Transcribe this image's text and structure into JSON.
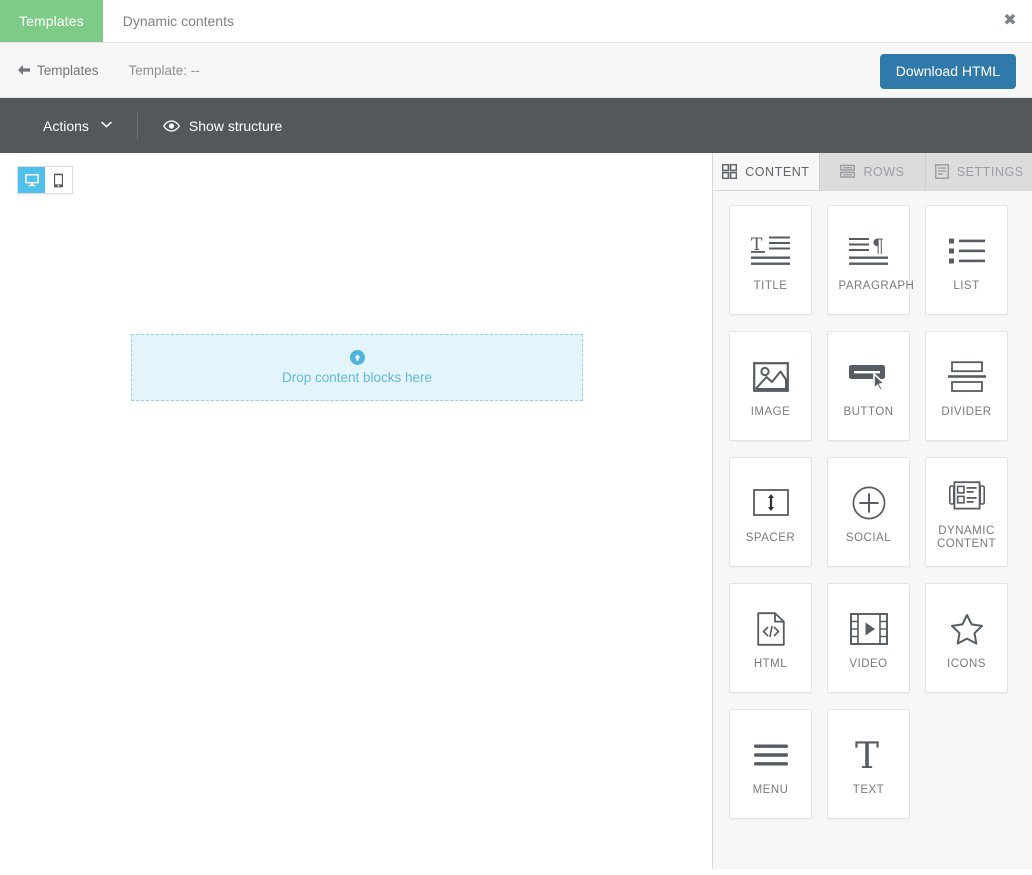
{
  "topbar": {
    "tabs": [
      {
        "label": "Templates",
        "active": true
      },
      {
        "label": "Dynamic contents",
        "active": false
      }
    ],
    "close_icon": "close-icon",
    "active_tab_color": "#7dcb87"
  },
  "subbar": {
    "back_label": "Templates",
    "back_icon": "arrow-left-icon",
    "template_label": "Template: --",
    "download_button": "Download HTML",
    "download_button_color": "#3079ab"
  },
  "toolbar": {
    "actions_label": "Actions",
    "actions_caret_icon": "chevron-down-icon",
    "show_structure_label": "Show structure",
    "show_structure_icon": "eye-icon",
    "background_color": "#52585c"
  },
  "canvas": {
    "device_toggle": [
      {
        "name": "desktop",
        "icon": "desktop-icon",
        "active": true
      },
      {
        "name": "mobile",
        "icon": "mobile-icon",
        "active": false
      }
    ],
    "active_device_color": "#4fc0ea",
    "dropzone": {
      "text": "Drop content blocks here",
      "icon": "arrow-up-circle-icon",
      "background_color": "#e3f4fb",
      "border_color": "#8ed2ec"
    }
  },
  "panel": {
    "tabs": [
      {
        "label": "CONTENT",
        "icon": "grid-icon",
        "active": true
      },
      {
        "label": "ROWS",
        "icon": "rows-icon",
        "active": false
      },
      {
        "label": "SETTINGS",
        "icon": "settings-document-icon",
        "active": false
      }
    ],
    "blocks": [
      {
        "label": "TITLE",
        "icon": "title-icon"
      },
      {
        "label": "PARAGRAPH",
        "icon": "paragraph-icon"
      },
      {
        "label": "LIST",
        "icon": "list-icon"
      },
      {
        "label": "IMAGE",
        "icon": "image-icon"
      },
      {
        "label": "BUTTON",
        "icon": "button-icon"
      },
      {
        "label": "DIVIDER",
        "icon": "divider-icon"
      },
      {
        "label": "SPACER",
        "icon": "spacer-icon"
      },
      {
        "label": "SOCIAL",
        "icon": "social-plus-icon"
      },
      {
        "label": "DYNAMIC CONTENT",
        "icon": "dynamic-content-icon"
      },
      {
        "label": "HTML",
        "icon": "html-code-icon"
      },
      {
        "label": "VIDEO",
        "icon": "video-icon"
      },
      {
        "label": "ICONS",
        "icon": "star-icon"
      },
      {
        "label": "MENU",
        "icon": "menu-hamburger-icon"
      },
      {
        "label": "TEXT",
        "icon": "text-t-icon"
      }
    ]
  }
}
